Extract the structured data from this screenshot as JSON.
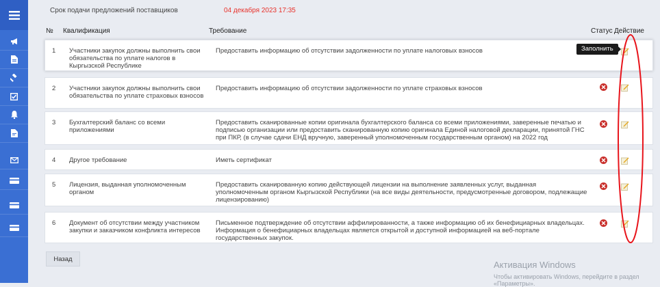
{
  "deadline": {
    "label": "Срок подачи предложений поставщиков",
    "value": "04 декабря 2023 17:35"
  },
  "table": {
    "headers": {
      "num": "№",
      "qualification": "Квалификация",
      "requirement": "Требование",
      "status": "Статус",
      "action": "Действие"
    },
    "rows": [
      {
        "num": "1",
        "qualification": "Участники закупок должны выполнить свои обязательства по уплате налогов в Кыргызской Республике",
        "requirement": "Предоставить информацию об отсутствии задолженности по уплате налоговых взносов",
        "status": "none"
      },
      {
        "num": "2",
        "qualification": "Участники закупок должны выполнить свои обязательства по уплате страховых взносов",
        "requirement": "Предоставить информацию об отсутствии задолженности по уплате страховых взносов",
        "status": "error"
      },
      {
        "num": "3",
        "qualification": "Бухгалтерский баланс со всеми приложениями",
        "requirement": "Предоставить сканированные копии оригинала бухгалтерского баланса со всеми приложениями, заверенные печатью и подписью организации или предоставить сканированную копию оригинала Единой налоговой декларации, принятой ГНС при ПКР, (в случае сдачи ЕНД вручную, заверенный уполномоченным государственным органом) на 2022 год",
        "status": "error"
      },
      {
        "num": "4",
        "qualification": "Другое требование",
        "requirement": "Иметь сертификат",
        "status": "error"
      },
      {
        "num": "5",
        "qualification": "Лицензия, выданная уполномоченным органом",
        "requirement": "Предоставить сканированную копию действующей лицензии на выполнение заявленных услуг, выданная уполномоченным органом Кыргызской Республики (на все виды деятельности, предусмотренные договором, подлежащие лицензированию)",
        "status": "error"
      },
      {
        "num": "6",
        "qualification": "Документ об отсутствии между участником закупки и заказчиком конфликта интересов",
        "requirement": "Письменное подтверждение об отсутствии аффилированности, а также информацию об их бенефициарных владельцах. Информация о бенефициарных владельцах является открытой и доступной информацией на веб-портале государственных закупок.",
        "status": "error"
      }
    ]
  },
  "tooltip": "Заполнить",
  "back_button": "Назад",
  "watermark": {
    "title": "Активация Windows",
    "subtitle": "Чтобы активировать Windows, перейдите в раздел «Параметры»."
  },
  "colors": {
    "sidebar": "#3a6fd3",
    "sidebar_top": "#2f5fc4",
    "deadline": "#e8312a",
    "status_error": "#c9302c",
    "annotation": "#e8141b"
  },
  "sidebar_icons": [
    "megaphone-icon",
    "document-icon",
    "gavel-icon",
    "checklist-icon",
    "bell-icon",
    "file-icon",
    "mail-icon",
    "card-icon",
    "card-icon",
    "card-icon"
  ]
}
